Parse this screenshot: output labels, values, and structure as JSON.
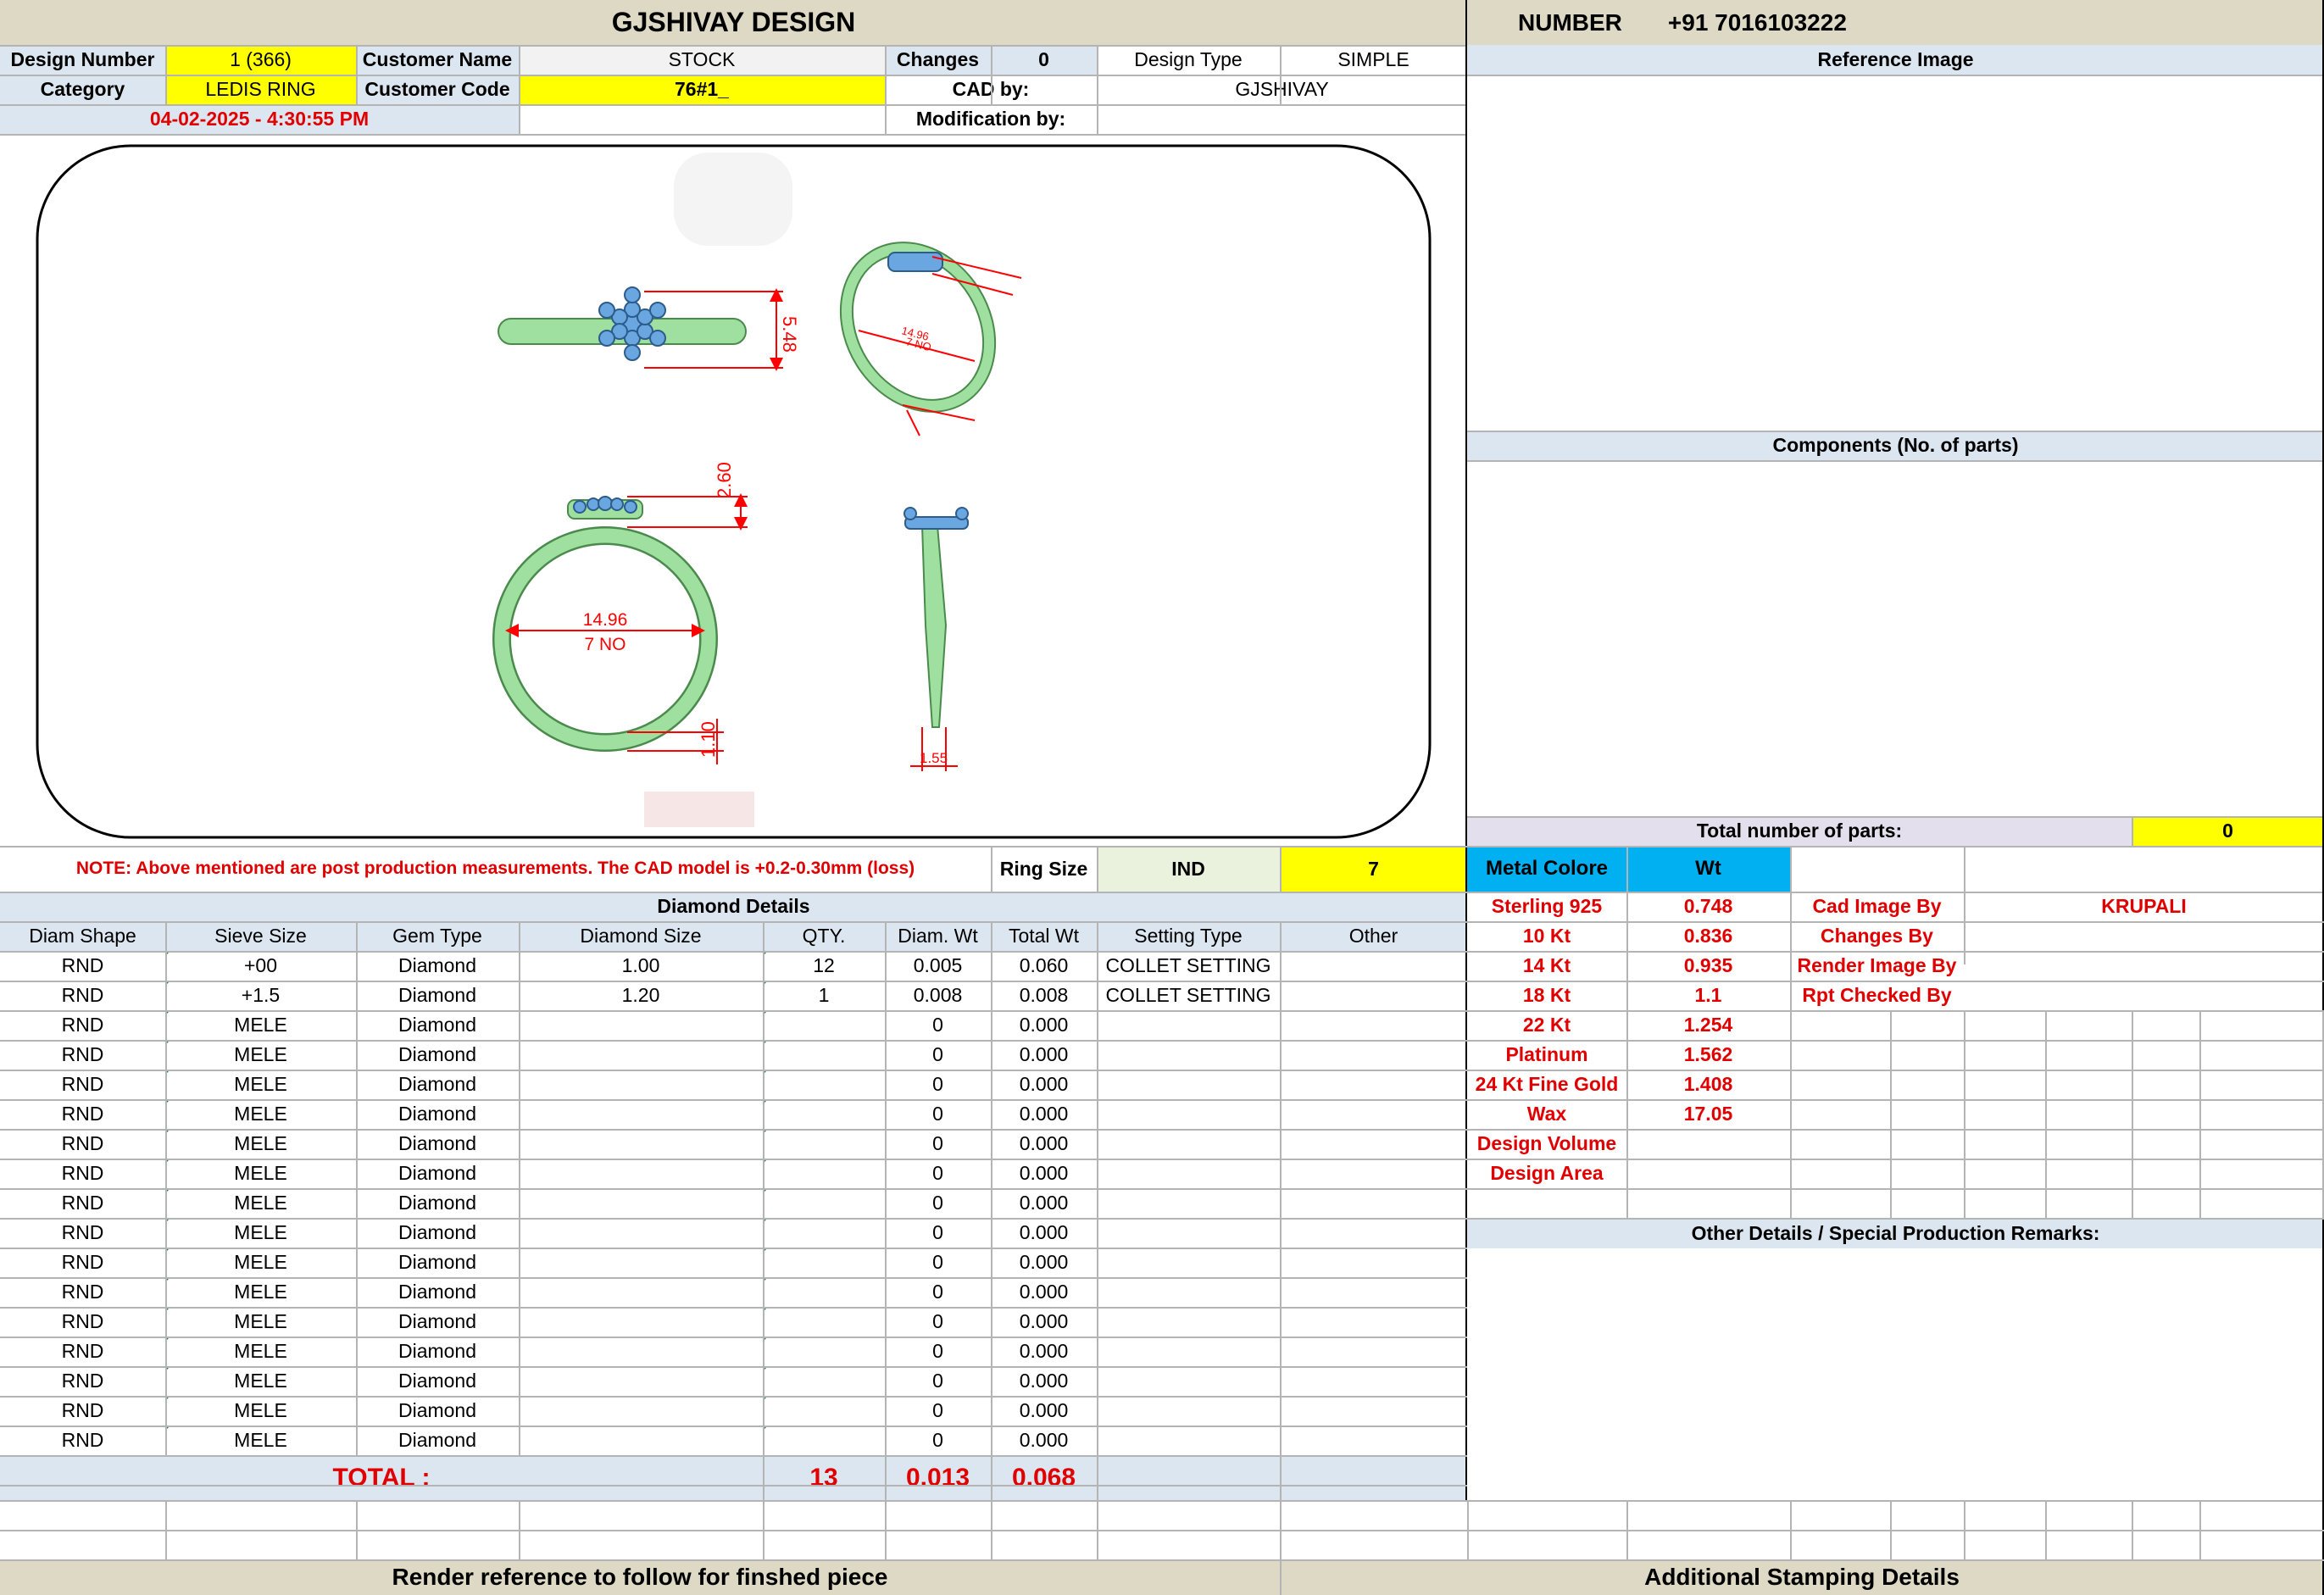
{
  "header": {
    "company": "GJSHIVAY DESIGN",
    "number_label": "NUMBER",
    "phone": "+91 7016103222"
  },
  "info": {
    "design_number_label": "Design Number",
    "design_number": "1 (366)",
    "customer_name_label": "Customer Name",
    "customer_name": "STOCK",
    "changes_label": "Changes",
    "changes": "0",
    "design_type_label": "Design Type",
    "design_type": "SIMPLE",
    "category_label": "Category",
    "category": "LEDIS RING",
    "customer_code_label": "Customer Code",
    "customer_code": "76#1_",
    "cad_by_label": "CAD by:",
    "cad_by": "GJSHIVAY",
    "datetime": "04-02-2025 - 4:30:55 PM",
    "modification_label": "Modification by:",
    "modification_by": ""
  },
  "cad": {
    "top_height": "5.48",
    "side_dim_a": "14.96",
    "side_dim_b": "7 NO",
    "front_top": "2.60",
    "front_dia": "14.96",
    "front_size": "7 NO",
    "front_bottom": "1.10",
    "profile_width": "1.55"
  },
  "note": "NOTE: Above mentioned are post production measurements. The CAD model is +0.2-0.30mm (loss)",
  "ring_size": {
    "label": "Ring Size",
    "standard": "IND",
    "value": "7"
  },
  "diamond": {
    "title": "Diamond Details",
    "headers": [
      "Diam Shape",
      "Sieve Size",
      "Gem Type",
      "Diamond Size",
      "QTY.",
      "Diam. Wt",
      "Total Wt",
      "Setting Type",
      "Other"
    ],
    "rows": [
      [
        "RND",
        "+00",
        "Diamond",
        "1.00",
        "12",
        "0.005",
        "0.060",
        "COLLET SETTING",
        ""
      ],
      [
        "RND",
        "+1.5",
        "Diamond",
        "1.20",
        "1",
        "0.008",
        "0.008",
        "COLLET SETTING",
        ""
      ],
      [
        "RND",
        "MELE",
        "Diamond",
        "",
        "",
        "0",
        "0.000",
        "",
        ""
      ],
      [
        "RND",
        "MELE",
        "Diamond",
        "",
        "",
        "0",
        "0.000",
        "",
        ""
      ],
      [
        "RND",
        "MELE",
        "Diamond",
        "",
        "",
        "0",
        "0.000",
        "",
        ""
      ],
      [
        "RND",
        "MELE",
        "Diamond",
        "",
        "",
        "0",
        "0.000",
        "",
        ""
      ],
      [
        "RND",
        "MELE",
        "Diamond",
        "",
        "",
        "0",
        "0.000",
        "",
        ""
      ],
      [
        "RND",
        "MELE",
        "Diamond",
        "",
        "",
        "0",
        "0.000",
        "",
        ""
      ],
      [
        "RND",
        "MELE",
        "Diamond",
        "",
        "",
        "0",
        "0.000",
        "",
        ""
      ],
      [
        "RND",
        "MELE",
        "Diamond",
        "",
        "",
        "0",
        "0.000",
        "",
        ""
      ],
      [
        "RND",
        "MELE",
        "Diamond",
        "",
        "",
        "0",
        "0.000",
        "",
        ""
      ],
      [
        "RND",
        "MELE",
        "Diamond",
        "",
        "",
        "0",
        "0.000",
        "",
        ""
      ],
      [
        "RND",
        "MELE",
        "Diamond",
        "",
        "",
        "0",
        "0.000",
        "",
        ""
      ],
      [
        "RND",
        "MELE",
        "Diamond",
        "",
        "",
        "0",
        "0.000",
        "",
        ""
      ],
      [
        "RND",
        "MELE",
        "Diamond",
        "",
        "",
        "0",
        "0.000",
        "",
        ""
      ],
      [
        "RND",
        "MELE",
        "Diamond",
        "",
        "",
        "0",
        "0.000",
        "",
        ""
      ],
      [
        "RND",
        "MELE",
        "Diamond",
        "",
        "",
        "0",
        "0.000",
        "",
        ""
      ]
    ],
    "total_label": "TOTAL :",
    "total_qty": "13",
    "total_diam_wt": "0.013",
    "total_wt": "0.068"
  },
  "right_panel": {
    "reference_image": "Reference Image",
    "components": "Components (No. of parts)",
    "total_parts_label": "Total number of parts:",
    "total_parts": "0",
    "metal_color_label": "Metal Colore",
    "wt_label": "Wt",
    "metals": [
      {
        "name": "Sterling 925",
        "wt": "0.748"
      },
      {
        "name": "10 Kt",
        "wt": "0.836"
      },
      {
        "name": "14 Kt",
        "wt": "0.935"
      },
      {
        "name": "18 Kt",
        "wt": "1.1"
      },
      {
        "name": "22 Kt",
        "wt": "1.254"
      },
      {
        "name": "Platinum",
        "wt": "1.562"
      },
      {
        "name": "24 Kt Fine Gold",
        "wt": "1.408"
      },
      {
        "name": "Wax",
        "wt": "17.05"
      },
      {
        "name": "Design Volume",
        "wt": ""
      },
      {
        "name": "Design Area",
        "wt": ""
      }
    ],
    "credits": [
      {
        "label": "Cad Image By",
        "value": "KRUPALI"
      },
      {
        "label": "Changes By",
        "value": ""
      },
      {
        "label": "Render Image By",
        "value": ""
      },
      {
        "label": "Rpt Checked By",
        "value": ""
      }
    ],
    "other_details": "Other Details / Special Production Remarks:"
  },
  "footer": {
    "render_ref": "Render reference to follow for finshed piece",
    "stamping": "Additional Stamping Details"
  },
  "colors": {
    "light_blue": "#dce6f1",
    "header_tan": "#ddd9c4",
    "highlight_yellow": "#ffff00",
    "metal_cyan": "#00b0f0",
    "ring_green": "#9fe0a0",
    "dimension_red": "#ff0000",
    "stone_blue": "#6aa6e0"
  }
}
